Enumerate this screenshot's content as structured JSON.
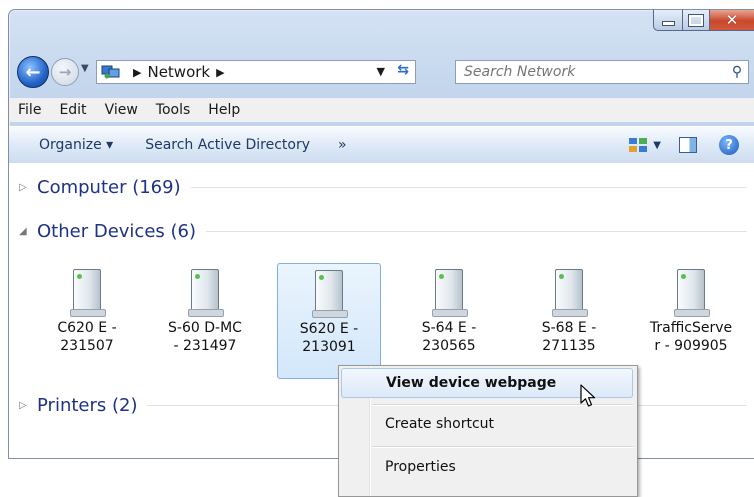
{
  "window": {
    "address": {
      "segments": [
        "Network"
      ]
    },
    "search": {
      "placeholder": "Search Network"
    },
    "menu": [
      "File",
      "Edit",
      "View",
      "Tools",
      "Help"
    ],
    "commands": {
      "organize": "Organize ▾",
      "search_ad": "Search Active Directory",
      "more": "»"
    }
  },
  "groups": [
    {
      "label": "Computer (169)",
      "expanded": false
    },
    {
      "label": "Other Devices (6)",
      "expanded": true
    },
    {
      "label": "Printers (2)",
      "expanded": false
    }
  ],
  "devices": [
    {
      "line1": "C620 E -",
      "line2": "231507"
    },
    {
      "line1": "S-60 D-MC",
      "line2": "- 231497"
    },
    {
      "line1": "S620 E -",
      "line2": "213091",
      "selected": true
    },
    {
      "line1": "S-64 E -",
      "line2": "230565"
    },
    {
      "line1": "S-68 E -",
      "line2": "271135"
    },
    {
      "line1": "TrafficServe",
      "line2": "r - 909905"
    }
  ],
  "context_menu": {
    "items": [
      "View device webpage",
      "Create shortcut",
      "Properties"
    ],
    "highlighted": 0
  }
}
